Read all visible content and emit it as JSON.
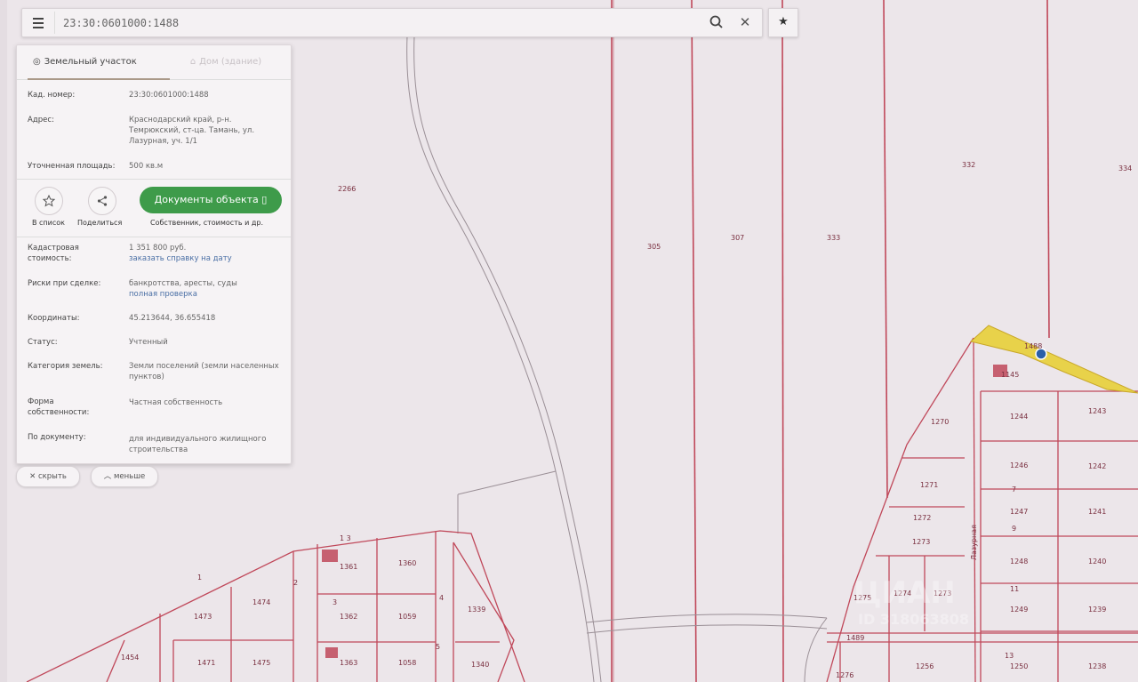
{
  "search": {
    "value": "23:30:0601000:1488"
  },
  "panel": {
    "tabs": [
      {
        "label": "Земельный участок"
      },
      {
        "label": "Дом (здание)"
      }
    ],
    "info": [
      {
        "label": "Кад. номер:",
        "value": "23:30:0601000:1488"
      },
      {
        "label": "Адрес:",
        "value": "Краснодарский край, р-н. Темрюкский, ст-ца. Тамань, ул. Лазурная, уч. 1/1"
      },
      {
        "label": "Уточненная площадь:",
        "value": "500 кв.м"
      }
    ],
    "actions": {
      "save_label": "В список",
      "share_label": "Поделиться",
      "docs_label": "Документы объекта",
      "docs_caption": "Собственник, стоимость и др."
    },
    "details": [
      {
        "label": "Кадастровая стоимость:",
        "value": "1 351 800 руб.",
        "link": "заказать справку на дату"
      },
      {
        "label": "Риски при сделке:",
        "value": "банкротства, аресты, суды",
        "link": "полная проверка"
      },
      {
        "label": "Координаты:",
        "value": "45.213644, 36.655418"
      },
      {
        "label": "Статус:",
        "value": "Учтенный"
      },
      {
        "label": "Категория земель:",
        "value": "Земли поселений (земли населенных пунктов)"
      },
      {
        "label": "Форма собственности:",
        "value": "Частная собственность"
      },
      {
        "label": "По документу:",
        "value": "для индивидуального жилищного строительства"
      }
    ]
  },
  "chips": {
    "hide_label": "скрыть",
    "less_label": "меньше"
  },
  "map": {
    "labels": [
      "2266",
      "305",
      "307",
      "333",
      "332",
      "334",
      "1488",
      "1145",
      "1244",
      "1243",
      "1270",
      "1271",
      "1272",
      "1246",
      "1242",
      "1247",
      "1241",
      "1248",
      "1240",
      "1249",
      "1239",
      "1250",
      "1238",
      "1275",
      "1274",
      "1273",
      "1276",
      "1256",
      "1489",
      "1273",
      "1361",
      "1360",
      "1362",
      "1059",
      "1363",
      "1058",
      "1473",
      "1474",
      "1471",
      "1475",
      "1454",
      "1339",
      "1340",
      "1",
      "2",
      "3",
      "4",
      "5",
      "7",
      "9",
      "11",
      "13",
      "1 3",
      "Лазурная"
    ],
    "watermark": "ЦИАН",
    "watermark_id": "ID 318063808"
  },
  "colors": {
    "parcel_line": "#c0485a",
    "highlight": "#e8d24a",
    "docs_button": "#3e9b4a",
    "link": "#4a6fa5"
  },
  "icons": [
    "menu-icon",
    "search-icon",
    "close-icon",
    "star-icon",
    "star-outline-icon",
    "share-icon",
    "document-icon",
    "pin-icon",
    "house-icon",
    "chevron-up-icon"
  ]
}
